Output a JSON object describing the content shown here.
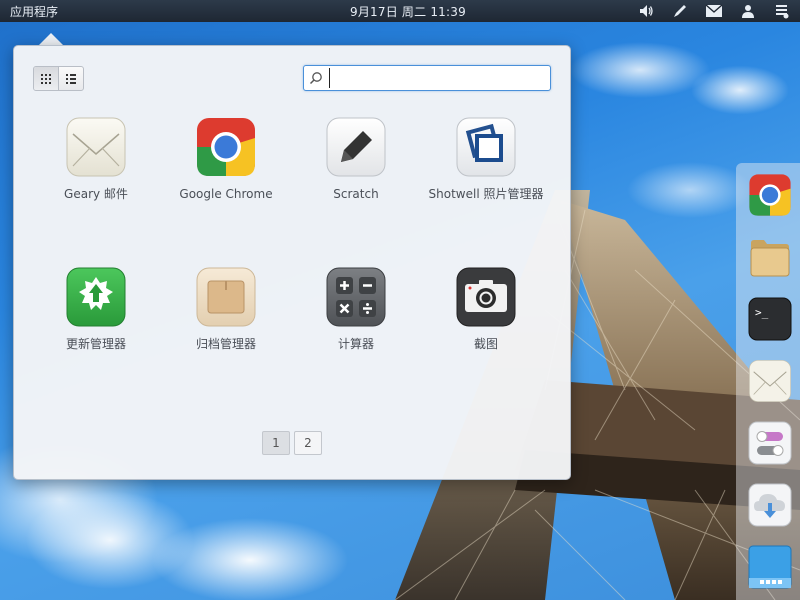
{
  "panel": {
    "apps_label": "应用程序",
    "clock": "9月17日 周二 11:39",
    "indicators": [
      "volume-icon",
      "pen-icon",
      "mail-icon",
      "user-icon",
      "menu-icon"
    ]
  },
  "launcher": {
    "search": {
      "value": "",
      "placeholder": ""
    },
    "views": [
      "grid-view-icon",
      "category-view-icon"
    ],
    "apps": [
      {
        "label": "Geary 邮件",
        "icon": "geary-icon"
      },
      {
        "label": "Google Chrome",
        "icon": "chrome-icon"
      },
      {
        "label": "Scratch",
        "icon": "scratch-icon"
      },
      {
        "label": "Shotwell  照片管理器",
        "icon": "shotwell-icon"
      },
      {
        "label": "更新管理器",
        "icon": "update-manager-icon"
      },
      {
        "label": "归档管理器",
        "icon": "archive-manager-icon"
      },
      {
        "label": "计算器",
        "icon": "calculator-icon"
      },
      {
        "label": "截图",
        "icon": "screenshot-icon"
      }
    ],
    "pages": [
      "1",
      "2"
    ],
    "active_page": "1"
  },
  "dock": {
    "items": [
      "chrome-icon",
      "files-icon",
      "terminal-icon",
      "mail-icon",
      "switchboard-icon",
      "cloud-download-icon",
      "desktop-icon"
    ]
  },
  "colors": {
    "panel_bg": "#1e2733",
    "sky": "#2a86e0",
    "accent": "#4a90d9"
  }
}
